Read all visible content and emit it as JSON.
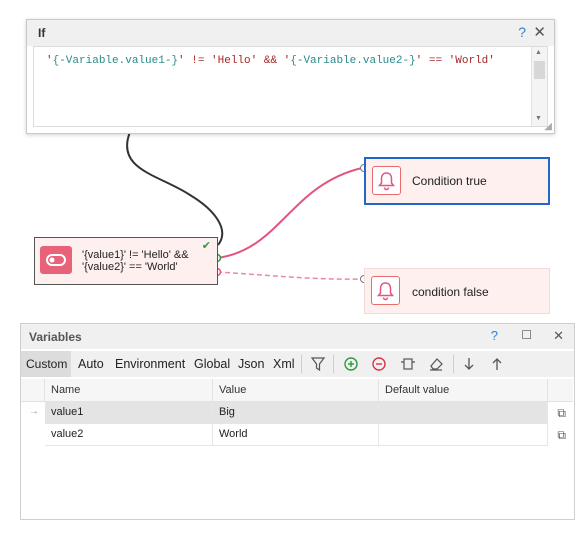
{
  "if_window": {
    "title": "If",
    "help": "?",
    "close": "✕",
    "code": {
      "p1": "'",
      "v1": "{-Variable.value1-}",
      "p2": "' != 'Hello' && '",
      "v2": "{-Variable.value2-}",
      "p3": "' == 'World'"
    }
  },
  "if_node": {
    "line1": "'{value1}' != 'Hello' &&",
    "line2": "'{value2}' == 'World'"
  },
  "nodes": {
    "true_label": "Condition true",
    "false_label": "condition false"
  },
  "variables": {
    "title": "Variables",
    "help": "?",
    "maximize": "☐",
    "close": "✕",
    "tabs": [
      "Custom",
      "Auto",
      "Environment",
      "Global",
      "Json",
      "Xml"
    ],
    "columns": [
      "Name",
      "Value",
      "Default value"
    ],
    "rows": [
      {
        "name": "value1",
        "value": "Big",
        "default": "",
        "selected": true
      },
      {
        "name": "value2",
        "value": "World",
        "default": "",
        "selected": false
      }
    ]
  },
  "colors": {
    "accent_blue": "#2167c8",
    "node_pink": "#e8637a",
    "connector_true": "#e3557c",
    "connector_false": "#e88aa6"
  }
}
